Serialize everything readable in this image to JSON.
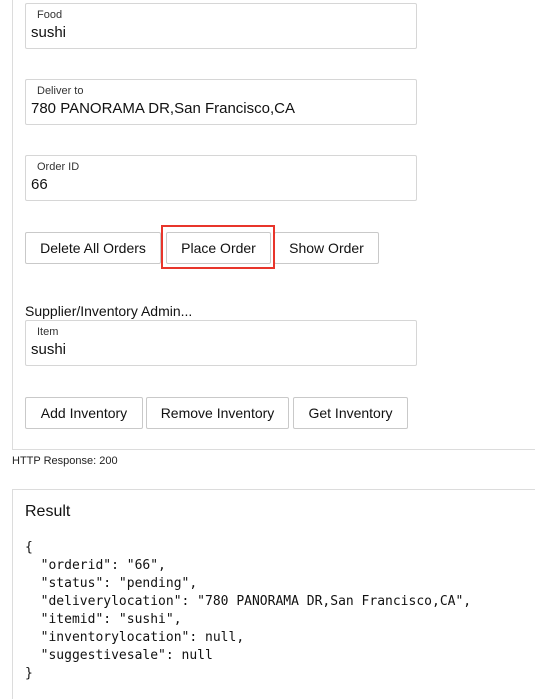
{
  "fields": {
    "food": {
      "label": "Food",
      "value": "sushi"
    },
    "deliver_to": {
      "label": "Deliver to",
      "value": "780 PANORAMA DR,San Francisco,CA"
    },
    "order_id": {
      "label": "Order ID",
      "value": "66"
    },
    "item": {
      "label": "Item",
      "value": "sushi"
    }
  },
  "order_buttons": {
    "delete_all": "Delete All Orders",
    "place_order": "Place Order",
    "show_order": "Show Order"
  },
  "supplier_section_label": "Supplier/Inventory Admin...",
  "inventory_buttons": {
    "add": "Add Inventory",
    "remove": "Remove Inventory",
    "get": "Get Inventory"
  },
  "http_response": "HTTP Response: 200",
  "result": {
    "title": "Result",
    "json_text": "{\n  \"orderid\": \"66\",\n  \"status\": \"pending\",\n  \"deliverylocation\": \"780 PANORAMA DR,San Francisco,CA\",\n  \"itemid\": \"sushi\",\n  \"inventorylocation\": null,\n  \"suggestivesale\": null\n}"
  },
  "colors": {
    "highlight": "#e8352b",
    "border": "#d6d6d6"
  }
}
